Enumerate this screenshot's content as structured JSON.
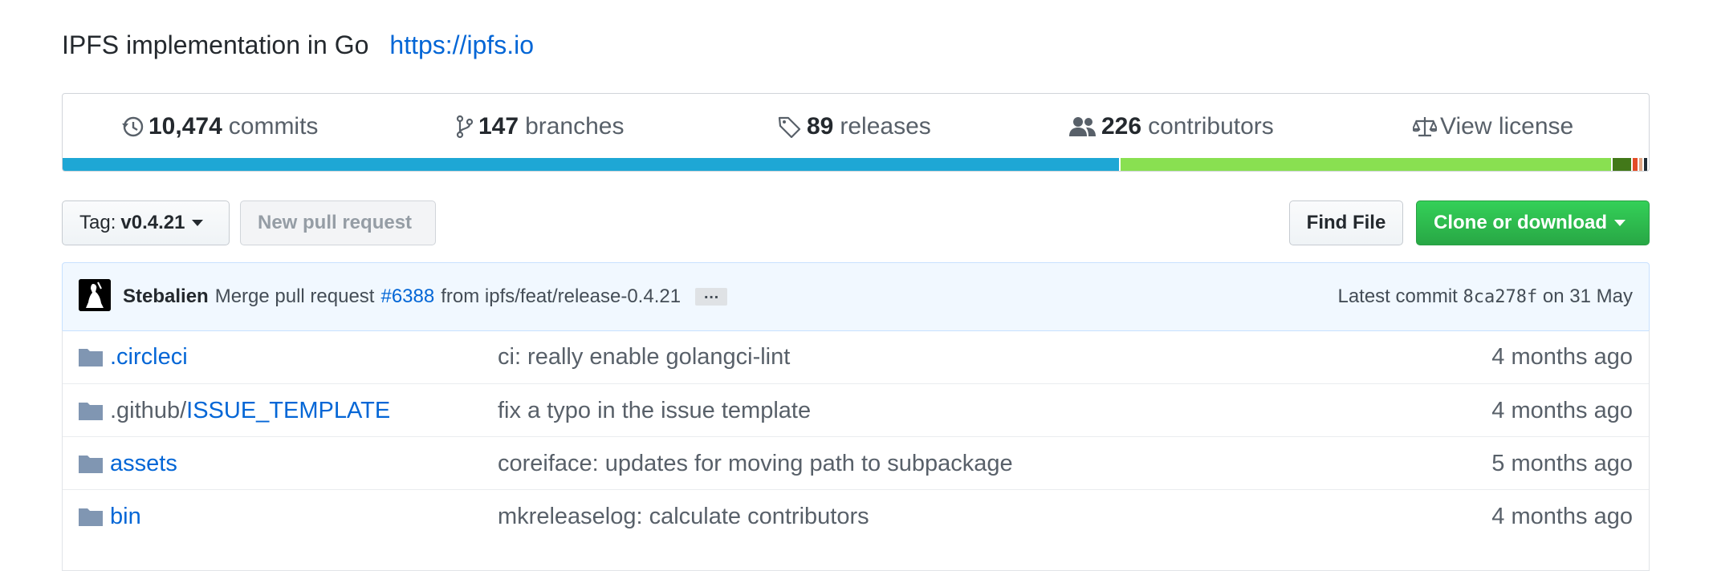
{
  "repo": {
    "description": "IPFS implementation in Go",
    "homepage": "https://ipfs.io"
  },
  "stats": {
    "commits": {
      "count": "10,474",
      "label": "commits",
      "icon": "history-icon"
    },
    "branches": {
      "count": "147",
      "label": "branches",
      "icon": "git-branch-icon"
    },
    "releases": {
      "count": "89",
      "label": "releases",
      "icon": "tag-icon"
    },
    "contributors": {
      "count": "226",
      "label": "contributors",
      "icon": "people-icon"
    },
    "license": {
      "label": "View license",
      "icon": "law-icon"
    }
  },
  "languages": [
    {
      "color": "#1ea7d5",
      "share": 66.6
    },
    {
      "color": "#89e051",
      "share": 31.0
    },
    {
      "color": "#427819",
      "share": 1.3
    },
    {
      "color": "#e34c26",
      "share": 0.4
    },
    {
      "color": "#dea584",
      "share": 0.3
    },
    {
      "color": "#1e2b35",
      "share": 0.3
    }
  ],
  "toolbar": {
    "branch_prefix": "Tag:",
    "branch_name": "v0.4.21",
    "new_pr_label": "New pull request",
    "find_file_label": "Find File",
    "clone_label": "Clone or download"
  },
  "latest_commit": {
    "author": "Stebalien",
    "message_prefix": "Merge pull request",
    "pr_number": "#6388",
    "message_suffix": "from ipfs/feat/release-0.4.21",
    "ellipsis": "…",
    "prefix": "Latest commit",
    "sha": "8ca278f",
    "date": "on 31 May"
  },
  "files": [
    {
      "dir": "",
      "name": ".circleci",
      "message": "ci: really enable golangci-lint",
      "age": "4 months ago"
    },
    {
      "dir": ".github/",
      "name": "ISSUE_TEMPLATE",
      "message": "fix a typo in the issue template",
      "age": "4 months ago"
    },
    {
      "dir": "",
      "name": "assets",
      "message": "coreiface: updates for moving path to subpackage",
      "age": "5 months ago"
    },
    {
      "dir": "",
      "name": "bin",
      "message": "mkreleaselog: calculate contributors",
      "age": "4 months ago"
    }
  ]
}
